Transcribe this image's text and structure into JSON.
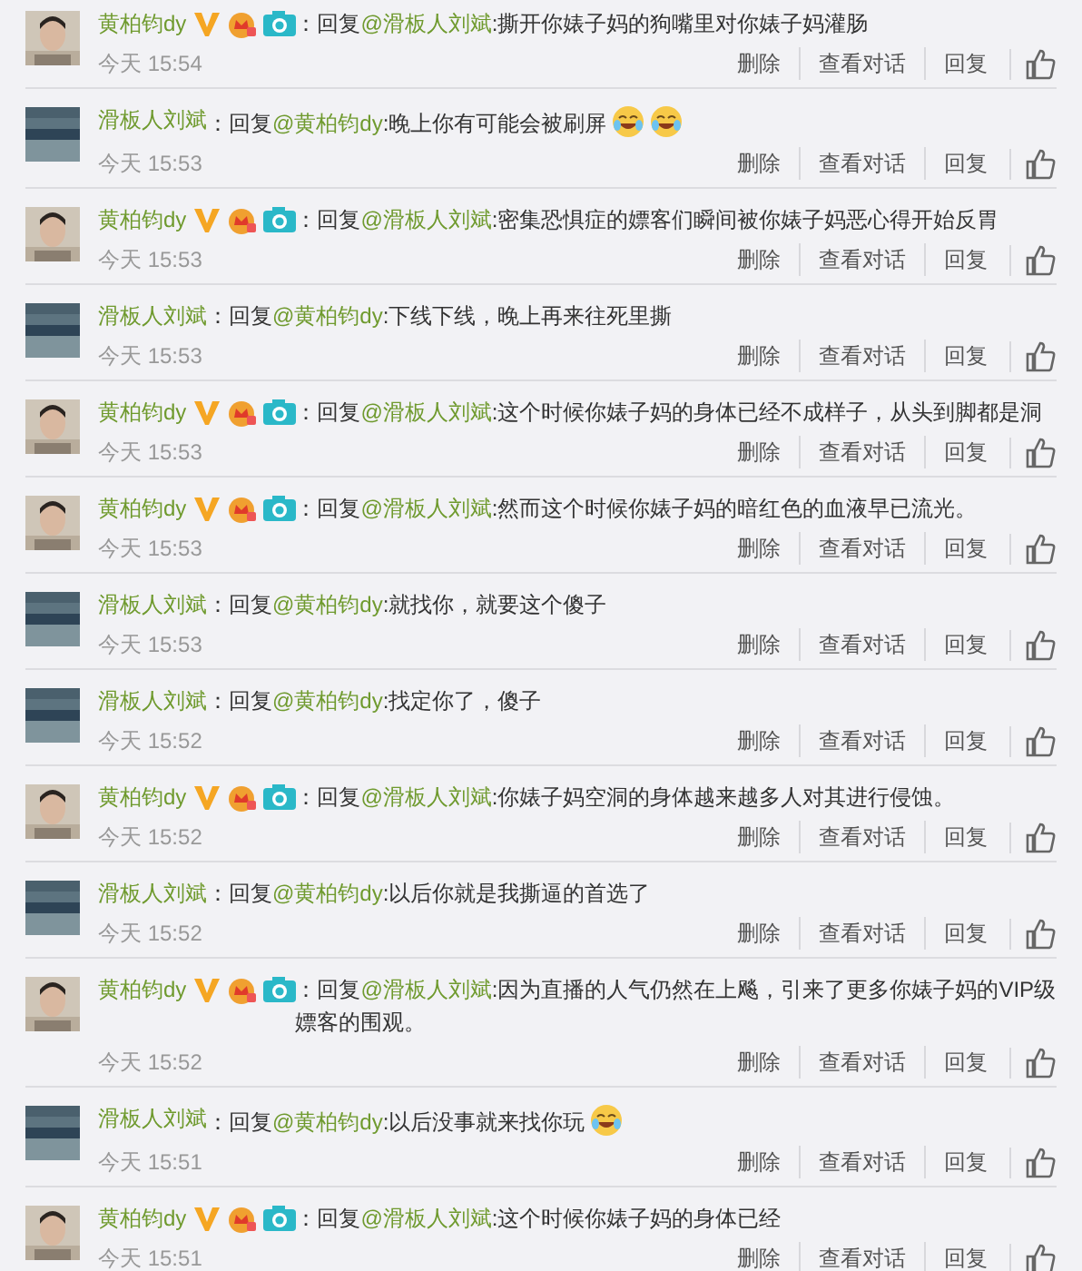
{
  "comments": [
    {
      "author": "黄柏钧dy",
      "verified": true,
      "reply_label": "：回复",
      "mention": "@滑板人刘斌",
      "text": ":撕开你婊子妈的狗嘴里对你婊子妈灌肠",
      "time": "今天 15:54",
      "actions": [
        "删除",
        "查看对话",
        "回复"
      ]
    },
    {
      "author": "滑板人刘斌",
      "verified": false,
      "reply_label": "：回复",
      "mention": "@黄柏钧dy",
      "text": ":晚上你有可能会被刷屏",
      "emojis": [
        {
          "kind": "laughing"
        },
        {
          "kind": "laughing"
        }
      ],
      "time": "今天 15:53",
      "actions": [
        "删除",
        "查看对话",
        "回复"
      ]
    },
    {
      "author": "黄柏钧dy",
      "verified": true,
      "reply_label": "：回复",
      "mention": "@滑板人刘斌",
      "text": ":密集恐惧症的嫖客们瞬间被你婊子妈恶心得开始反胃",
      "time": "今天 15:53",
      "actions": [
        "删除",
        "查看对话",
        "回复"
      ]
    },
    {
      "author": "滑板人刘斌",
      "verified": false,
      "reply_label": "：回复",
      "mention": "@黄柏钧dy",
      "text": ":下线下线，晚上再来往死里撕",
      "time": "今天 15:53",
      "actions": [
        "删除",
        "查看对话",
        "回复"
      ]
    },
    {
      "author": "黄柏钧dy",
      "verified": true,
      "reply_label": "：回复",
      "mention": "@滑板人刘斌",
      "text": ":这个时候你婊子妈的身体已经不成样子，从头到脚都是洞",
      "time": "今天 15:53",
      "actions": [
        "删除",
        "查看对话",
        "回复"
      ]
    },
    {
      "author": "黄柏钧dy",
      "verified": true,
      "reply_label": "：回复",
      "mention": "@滑板人刘斌",
      "text": ":然而这个时候你婊子妈的暗红色的血液早已流光。",
      "time": "今天 15:53",
      "actions": [
        "删除",
        "查看对话",
        "回复"
      ]
    },
    {
      "author": "滑板人刘斌",
      "verified": false,
      "reply_label": "：回复",
      "mention": "@黄柏钧dy",
      "text": ":就找你，就要这个傻子",
      "time": "今天 15:53",
      "actions": [
        "删除",
        "查看对话",
        "回复"
      ]
    },
    {
      "author": "滑板人刘斌",
      "verified": false,
      "reply_label": "：回复",
      "mention": "@黄柏钧dy",
      "text": ":找定你了，傻子",
      "time": "今天 15:52",
      "actions": [
        "删除",
        "查看对话",
        "回复"
      ]
    },
    {
      "author": "黄柏钧dy",
      "verified": true,
      "reply_label": "：回复",
      "mention": "@滑板人刘斌",
      "text": ":你婊子妈空洞的身体越来越多人对其进行侵蚀。",
      "time": "今天 15:52",
      "actions": [
        "删除",
        "查看对话",
        "回复"
      ]
    },
    {
      "author": "滑板人刘斌",
      "verified": false,
      "reply_label": "：回复",
      "mention": "@黄柏钧dy",
      "text": ":以后你就是我撕逼的首选了",
      "time": "今天 15:52",
      "actions": [
        "删除",
        "查看对话",
        "回复"
      ]
    },
    {
      "author": "黄柏钧dy",
      "verified": true,
      "reply_label": "：回复",
      "mention": "@滑板人刘斌",
      "text": ":因为直播的人气仍然在上飚，引来了更多你婊子妈的VIP级嫖客的围观。",
      "time": "今天 15:52",
      "actions": [
        "删除",
        "查看对话",
        "回复"
      ]
    },
    {
      "author": "滑板人刘斌",
      "verified": false,
      "reply_label": "：回复",
      "mention": "@黄柏钧dy",
      "text": ":以后没事就来找你玩",
      "emojis": [
        {
          "kind": "laughing"
        }
      ],
      "time": "今天 15:51",
      "actions": [
        "删除",
        "查看对话",
        "回复"
      ]
    },
    {
      "author": "黄柏钧dy",
      "verified": true,
      "reply_label": "：回复",
      "mention": "@滑板人刘斌",
      "text": ":这个时候你婊子妈的身体已经",
      "time": "今天 15:51",
      "actions": [
        "删除",
        "查看对话",
        "回复"
      ]
    }
  ]
}
